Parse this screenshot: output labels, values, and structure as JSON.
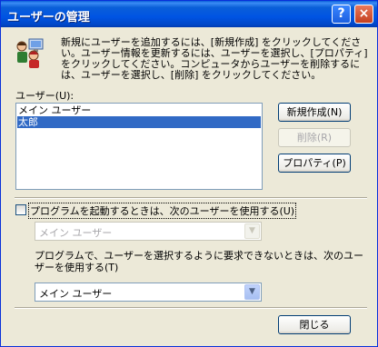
{
  "window": {
    "title": "ユーザーの管理",
    "help_btn": "?",
    "close_btn": "×"
  },
  "info_text": "新規にユーザーを追加するには、[新規作成] をクリックしてください。ユーザー情報を更新するには、ユーザーを選択し、[プロパティ] をクリックしてください。コンピュータからユーザーを削除するには、ユーザーを選択し、[削除] をクリックしてください。",
  "users_label": "ユーザー(U):",
  "users": [
    {
      "name": "メイン ユーザー",
      "selected": false
    },
    {
      "name": "太郎",
      "selected": true
    }
  ],
  "buttons": {
    "new": "新規作成(N)",
    "delete": "削除(R)",
    "properties": "プロパティ(P)",
    "close": "閉じる"
  },
  "checkbox_label": "プログラムを起動するときは、次のユーザーを使用する(U)",
  "startup_user_select": "メイン ユーザー",
  "desc2": "プログラムで、ユーザーを選択するように要求できないときは、次のユーザーを使用する(T)",
  "fallback_user_select": "メイン ユーザー",
  "icons": {
    "users": "users-icon"
  }
}
